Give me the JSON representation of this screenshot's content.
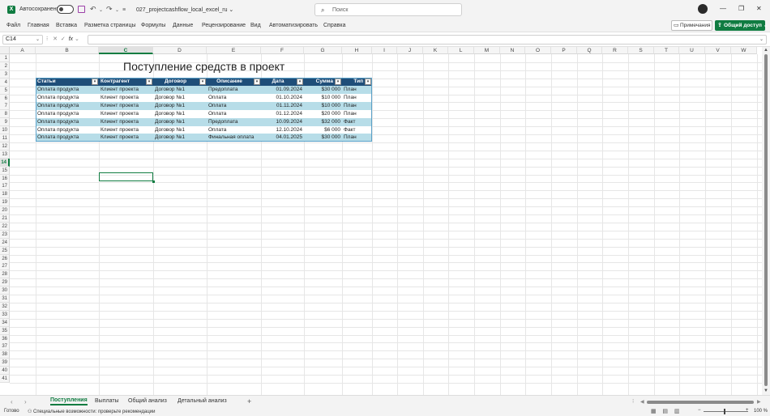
{
  "titlebar": {
    "autosave_label": "Автосохранение",
    "filename": "027_projectcashflow_local_excel_ru",
    "search_placeholder": "Поиск"
  },
  "ribbon": {
    "tabs": [
      "Файл",
      "Главная",
      "Вставка",
      "Разметка страницы",
      "Формулы",
      "Данные",
      "Рецензирование",
      "Вид",
      "Автоматизировать",
      "Справка"
    ],
    "notes_label": "Примечания",
    "share_label": "Общий доступ"
  },
  "formula_bar": {
    "name_box": "C14",
    "fx_label": "fx",
    "value": ""
  },
  "grid": {
    "columns": [
      "A",
      "B",
      "C",
      "D",
      "E",
      "F",
      "G",
      "H",
      "I",
      "J",
      "K",
      "L",
      "M",
      "N",
      "O",
      "P",
      "Q",
      "R",
      "S",
      "T",
      "U",
      "V",
      "W"
    ],
    "selected_column": "C",
    "rows": [
      "1",
      "2",
      "3",
      "4",
      "5",
      "6",
      "7",
      "8",
      "9",
      "10",
      "11",
      "12",
      "13",
      "14",
      "15",
      "16",
      "17",
      "18",
      "19",
      "20",
      "21",
      "22",
      "23",
      "24",
      "25",
      "26",
      "27",
      "28",
      "29",
      "30",
      "31",
      "32",
      "33",
      "34",
      "35",
      "36",
      "37",
      "38",
      "39",
      "40",
      "41"
    ],
    "selected_row": "14"
  },
  "sheet": {
    "title": "Поступление средств в проект",
    "headers": [
      "Статьи",
      "Контрагент",
      "Договор",
      "Описание",
      "Дата",
      "Сумма",
      "Тип"
    ],
    "rows": [
      [
        "Оплата продукта",
        "Клиент проекта",
        "Договор №1",
        "Предоплата",
        "01.09.2024",
        "$30 000",
        "План"
      ],
      [
        "Оплата продукта",
        "Клиент проекта",
        "Договор №1",
        "Оплата",
        "01.10.2024",
        "$10 000",
        "План"
      ],
      [
        "Оплата продукта",
        "Клиент проекта",
        "Договор №1",
        "Оплата",
        "01.11.2024",
        "$10 000",
        "План"
      ],
      [
        "Оплата продукта",
        "Клиент проекта",
        "Договор №1",
        "Оплата",
        "01.12.2024",
        "$20 000",
        "План"
      ],
      [
        "Оплата продукта",
        "Клиент проекта",
        "Договор №1",
        "Предоплата",
        "10.09.2024",
        "$32 000",
        "Факт"
      ],
      [
        "Оплата продукта",
        "Клиент проекта",
        "Договор №1",
        "Оплата",
        "12.10.2024",
        "$6 000",
        "Факт"
      ],
      [
        "Оплата продукта",
        "Клиент проекта",
        "Договор №1",
        "Финальная оплата",
        "04.01.2025",
        "$30 000",
        "План"
      ]
    ]
  },
  "sheet_tabs": {
    "tabs": [
      "Поступления",
      "Выплаты",
      "Общий анализ",
      "Детальный анализ"
    ],
    "active": "Поступления"
  },
  "status": {
    "ready": "Готово",
    "accessibility": "Специальные возможности: проверьте рекомендации",
    "zoom": "100 %"
  },
  "colors": {
    "accent": "#107c41",
    "table_header": "#1f4e79",
    "table_band": "#b7dde8"
  }
}
